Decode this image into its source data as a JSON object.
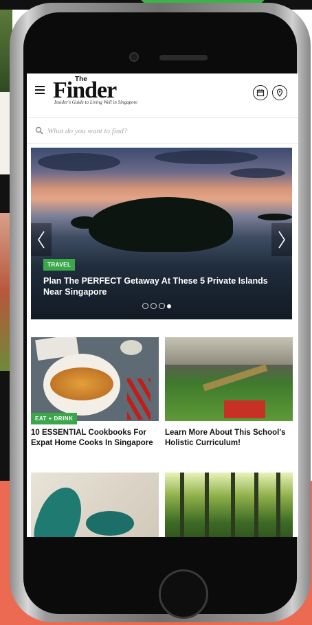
{
  "brand": {
    "logo_main": "Finder",
    "logo_the": "The",
    "tagline": "Insider's Guide to Living Well in Singapore"
  },
  "header": {
    "menu_icon": "hamburger-menu-icon",
    "calendar_icon": "calendar-icon",
    "location_icon": "location-pin-icon"
  },
  "search": {
    "placeholder": "What do you want to find?",
    "icon": "search-icon"
  },
  "hero": {
    "tag": "TRAVEL",
    "title": "Plan The PERFECT Getaway At These 5 Private Islands Near Singapore",
    "slide_count": 4,
    "active_slide": 4
  },
  "cards": [
    {
      "tag": "EAT + DRINK",
      "title": "10 ESSENTIAL Cookbooks For Expat Home Cooks In Singapore"
    },
    {
      "tag": "",
      "title": "Learn More About This School's Holistic Curriculum!"
    },
    {
      "tag": "",
      "title": ""
    },
    {
      "tag": "",
      "title": ""
    }
  ],
  "colors": {
    "tag_green": "#3aa84a",
    "background_coral": "#ec6a52",
    "phone_frame": "#0b0b0b"
  }
}
